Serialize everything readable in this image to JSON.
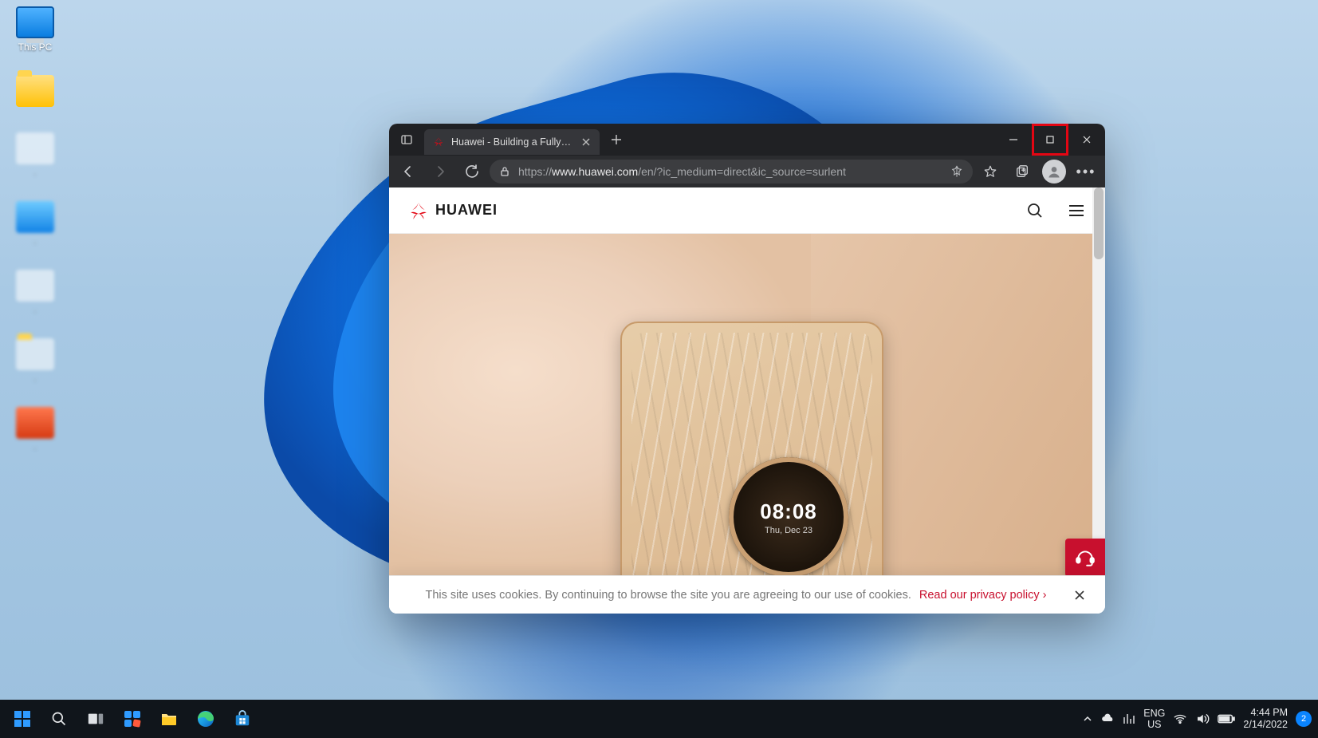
{
  "desktop": {
    "icons": [
      {
        "name": "this-pc",
        "label": "This PC"
      },
      {
        "name": "folder",
        "label": ""
      }
    ]
  },
  "browser": {
    "tab_title": "Huawei - Building a Fully Connec",
    "url_prefix": "https://",
    "url_host": "www.huawei.com",
    "url_path": "/en/?ic_medium=direct&ic_source=surlent"
  },
  "site": {
    "brand": "HUAWEI",
    "hero_clock_time": "08:08",
    "hero_clock_date": "Thu, Dec 23",
    "cookie_text": "This site uses cookies. By continuing to browse the site you are agreeing to our use of cookies.",
    "cookie_link": "Read our privacy policy"
  },
  "taskbar": {
    "lang_top": "ENG",
    "lang_bottom": "US",
    "time": "4:44 PM",
    "date": "2/14/2022",
    "notif_count": "2"
  }
}
